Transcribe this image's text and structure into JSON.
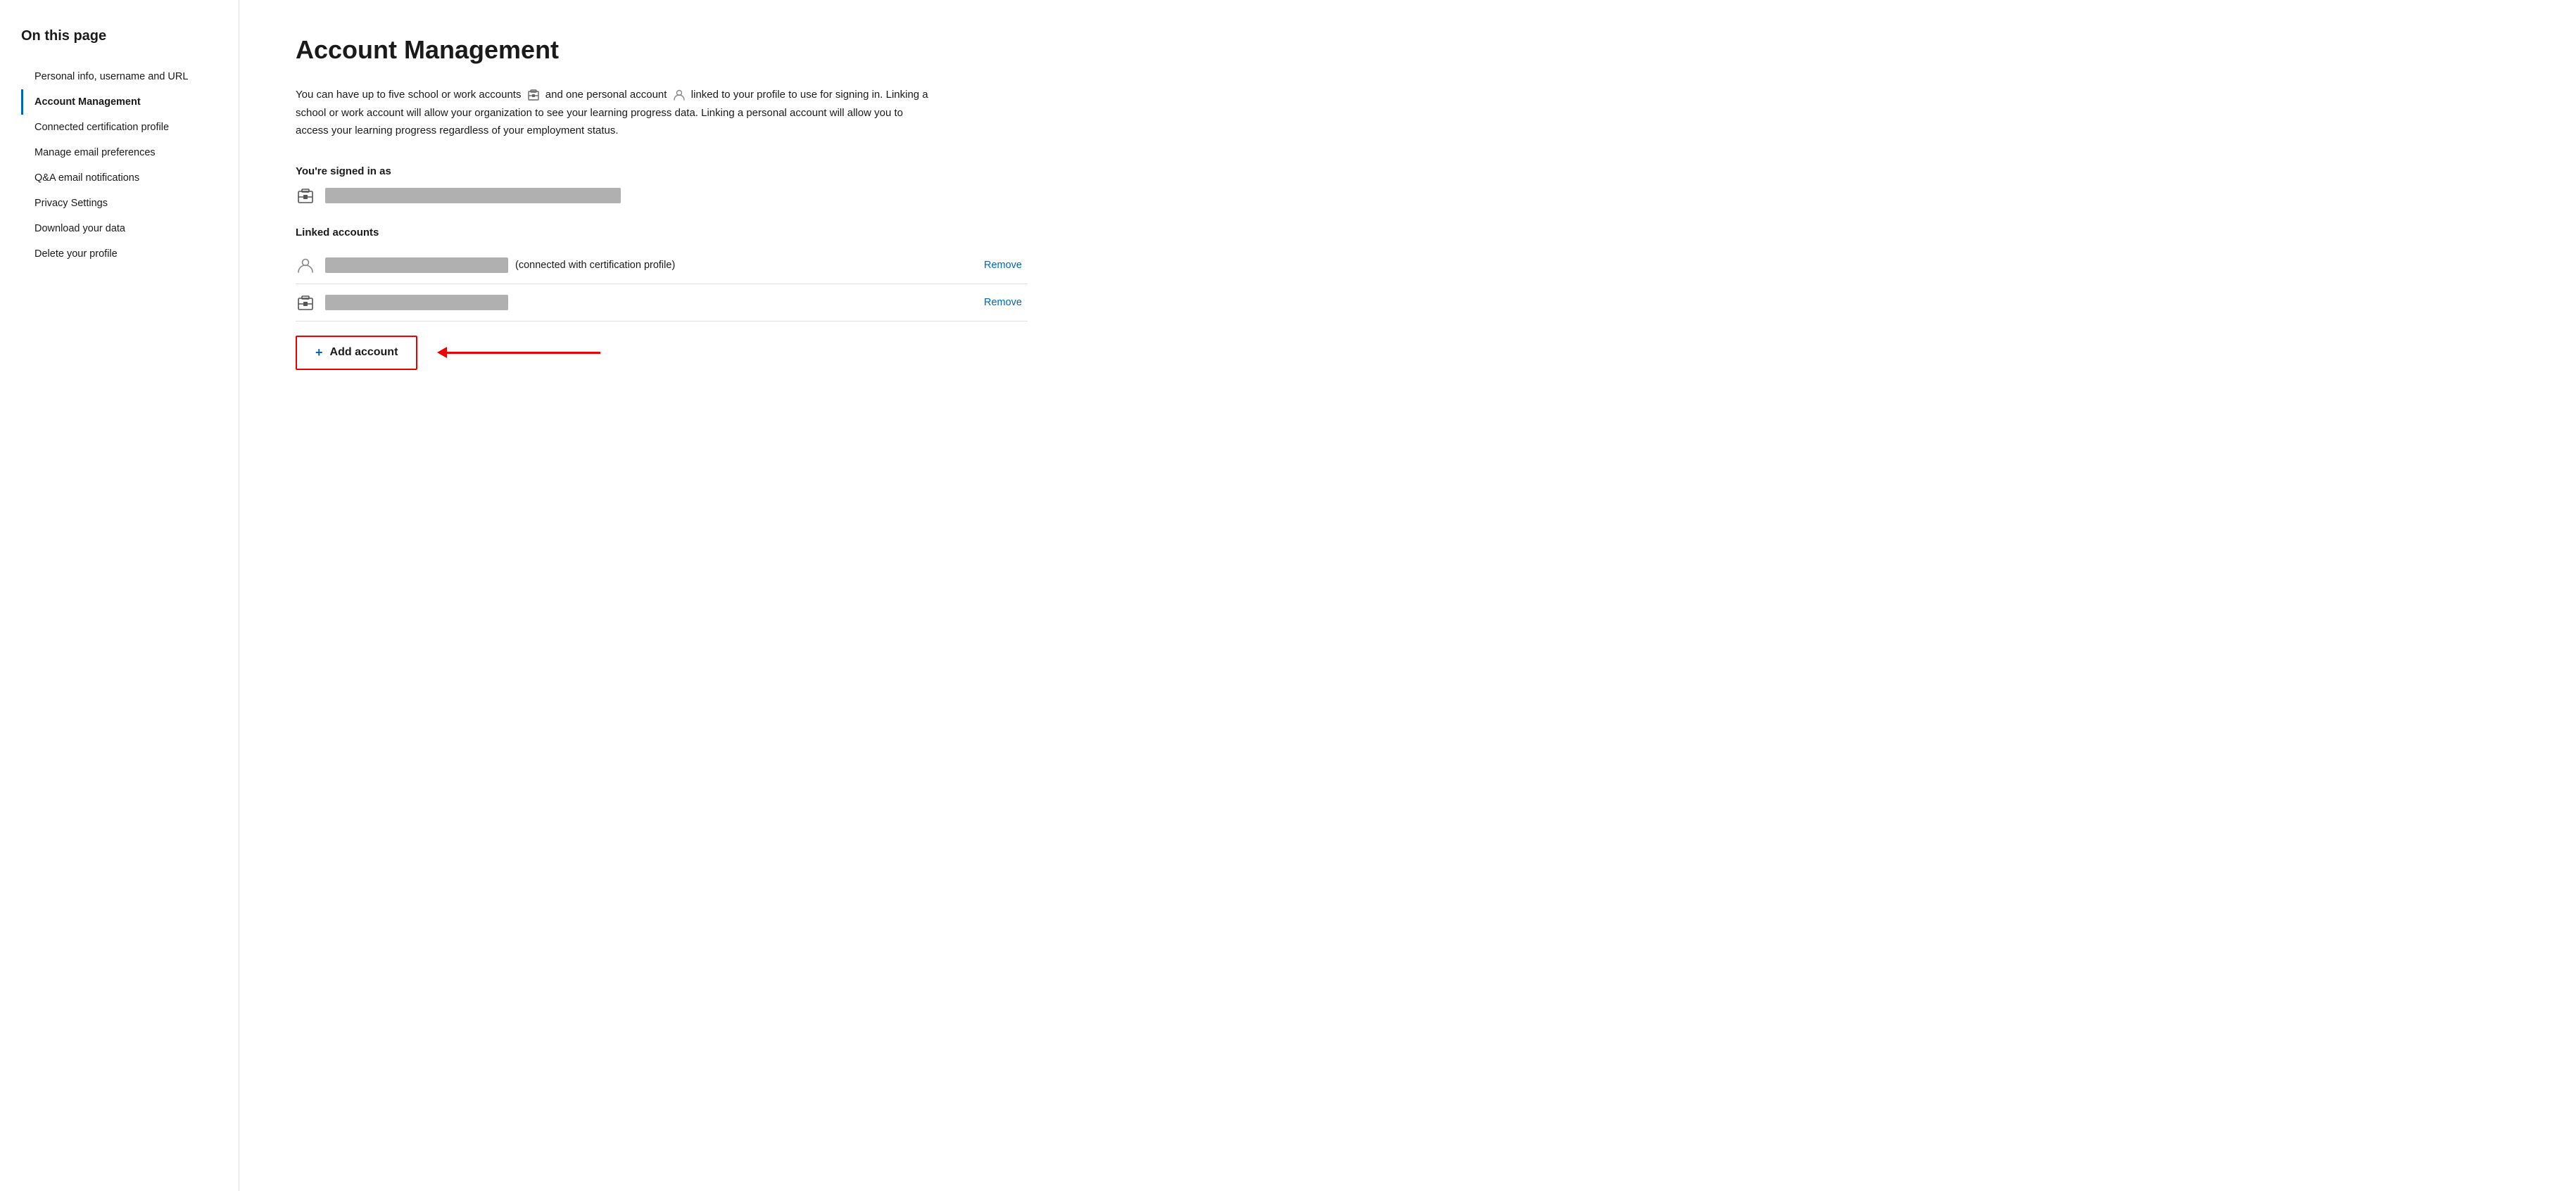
{
  "sidebar": {
    "title": "On this page",
    "items": [
      {
        "id": "personal-info",
        "label": "Personal info, username and URL",
        "active": false
      },
      {
        "id": "account-management",
        "label": "Account Management",
        "active": true
      },
      {
        "id": "connected-cert",
        "label": "Connected certification profile",
        "active": false
      },
      {
        "id": "manage-email",
        "label": "Manage email preferences",
        "active": false
      },
      {
        "id": "qa-email",
        "label": "Q&A email notifications",
        "active": false
      },
      {
        "id": "privacy-settings",
        "label": "Privacy Settings",
        "active": false
      },
      {
        "id": "download-data",
        "label": "Download your data",
        "active": false
      },
      {
        "id": "delete-profile",
        "label": "Delete your profile",
        "active": false
      }
    ]
  },
  "main": {
    "title": "Account Management",
    "description": "You can have up to five school or work accounts  and one personal account  linked to your profile to use for signing in. Linking a school or work account will allow your organization to see your learning progress data. Linking a personal account will allow you to access your learning progress regardless of your employment status.",
    "signed_in_label": "You're signed in as",
    "linked_accounts_label": "Linked accounts",
    "cert_note": "(connected with certification profile)",
    "remove_label": "Remove",
    "add_account_label": "Add account"
  }
}
